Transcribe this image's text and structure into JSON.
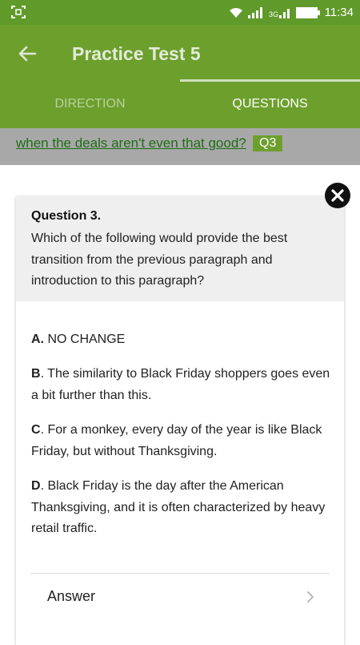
{
  "status_bar": {
    "time": "11:34",
    "left_icon": "screenshot-icon",
    "icons": [
      "wifi-icon",
      "signal-icon",
      "signal-3g-icon",
      "battery-icon"
    ]
  },
  "app_bar": {
    "title": "Practice Test 5",
    "back_icon": "arrow-back-icon",
    "tabs": [
      {
        "label": "DIRECTION",
        "active": false
      },
      {
        "label": "QUESTIONS",
        "active": true
      }
    ]
  },
  "passage": {
    "text": "when the deals aren't even that good?",
    "badge": "Q3"
  },
  "question": {
    "number_label": "Question 3.",
    "text": "Which of the following would provide the best transition from the previous paragraph and introduction to this paragraph?",
    "options": [
      {
        "letter": "A.",
        "text": " NO CHANGE"
      },
      {
        "letter": "B",
        "text": ". The similarity to Black Friday shoppers goes even a bit further than this."
      },
      {
        "letter": "C",
        "text": ". For a monkey, every day of the year is like Black Friday, but without Thanksgiving."
      },
      {
        "letter": "D",
        "text": ". Black Friday is the day after the American Thanksgiving, and it is often characterized by heavy retail traffic."
      }
    ],
    "answer_label": "Answer"
  },
  "colors": {
    "status_bar": "#5f9a2a",
    "app_bar": "#6d9f2d",
    "passage_link": "#1e6e14",
    "passage_strip": "#a8a8a8"
  }
}
